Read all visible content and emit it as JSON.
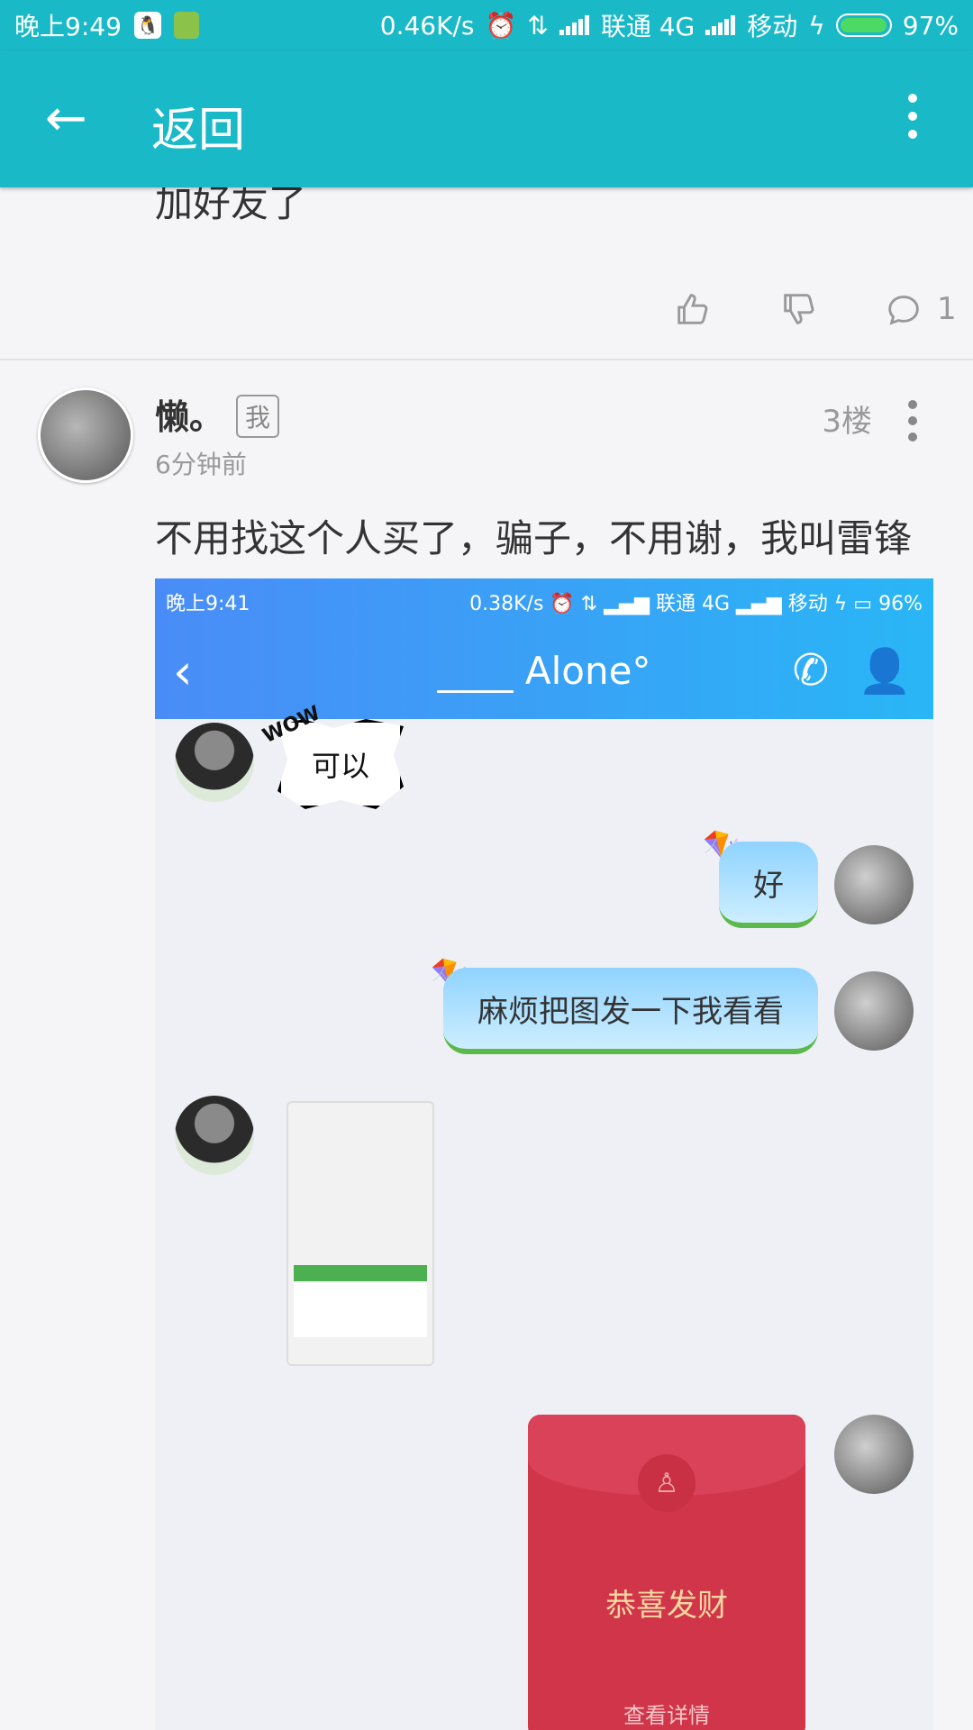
{
  "status_bar": {
    "time": "晚上9:49",
    "speed": "0.46K/s",
    "carrier1": "联通 4G",
    "carrier2": "移动",
    "battery": "97%"
  },
  "app_bar": {
    "back_icon": "←",
    "title": "返回"
  },
  "previous_post": {
    "text_partial": "加好友了",
    "comment_count": "1"
  },
  "post": {
    "username": "懒。",
    "badge": "我",
    "floor": "3楼",
    "time_ago": "6分钟前",
    "text": "不用找这个人买了，骗子，不用谢，我叫雷锋"
  },
  "screenshot": {
    "status": {
      "time": "晚上9:41",
      "speed": "0.38K/s",
      "carrier1": "联通 4G",
      "carrier2": "移动",
      "battery": "96%"
    },
    "nav": {
      "title": "____ Alone°"
    },
    "messages": [
      {
        "from": "other",
        "type": "sticker",
        "text": "可以",
        "sticker_label": "WOW"
      },
      {
        "from": "self",
        "type": "text",
        "text": "好"
      },
      {
        "from": "self",
        "type": "text",
        "text": "麻烦把图发一下我看看"
      },
      {
        "from": "other",
        "type": "image"
      },
      {
        "from": "self",
        "type": "red_packet",
        "text": "恭喜发财",
        "detail": "查看详情"
      }
    ]
  },
  "colors": {
    "app_bar": "#1ab9c8",
    "red_packet": "#d0354a"
  }
}
